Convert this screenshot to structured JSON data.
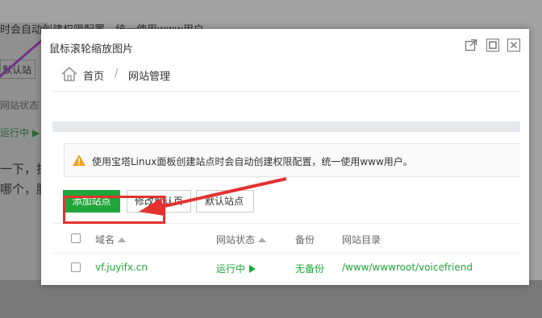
{
  "background": {
    "line1": "时会自动创建权限配置，统一使用www用户",
    "button": "默认站点",
    "col": "网站状态",
    "status": "运行中 ▶",
    "text1": "一下，抹",
    "text2": "哪个，脂"
  },
  "dialog": {
    "title": "鼠标滚轮缩放图片",
    "controls": [
      "external-icon",
      "maximize-icon",
      "close-icon"
    ]
  },
  "breadcrumb": {
    "home": "首页",
    "separator": "/",
    "current": "网站管理"
  },
  "alert": {
    "text": "使用宝塔Linux面板创建站点时会自动创建权限配置，统一使用www用户。"
  },
  "toolbar": {
    "add_site": "添加站点",
    "edit_default": "修改默认页",
    "truncated": "默认站点"
  },
  "table": {
    "headers": [
      "域名",
      "网站状态",
      "备份",
      "网站目录"
    ],
    "rows": [
      {
        "domain": "vf.juyifx.cn",
        "status": "运行中",
        "backup": "无备份",
        "path": "/www/wwwroot/voicefriend"
      }
    ]
  },
  "colors": {
    "accent_green": "#20a53a",
    "highlight_red": "#e3322f"
  }
}
